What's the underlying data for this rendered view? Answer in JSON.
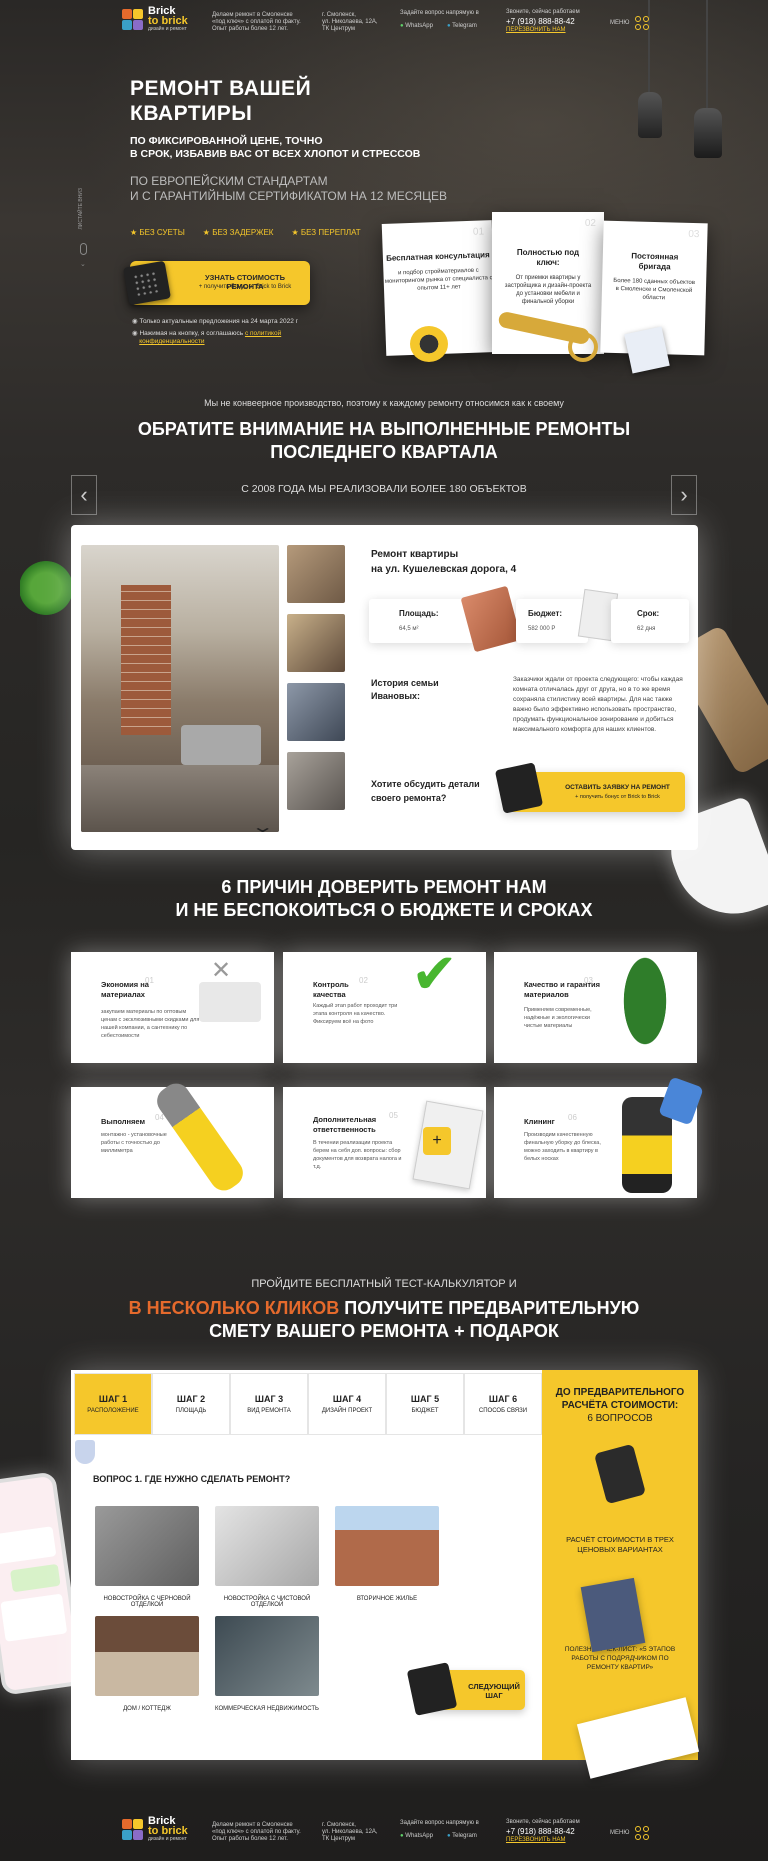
{
  "header": {
    "logo_line1": "Brick",
    "logo_line2": "to brick",
    "logo_tag": "дизайн и ремонт",
    "about": [
      "Делаем ремонт в Смоленске",
      "«под ключ» с оплатой по факту.",
      "Опыт работы более 12 лет."
    ],
    "address": [
      "г. Смоленск,",
      "ул. Николаева, 12А,",
      "ТК Центрум"
    ],
    "ask_label": "Задайте вопрос напрямую в",
    "whatsapp": "WhatsApp",
    "telegram": "Telegram",
    "call_label": "Звоните, сейчас работаем",
    "phone": "+7 (918) 888-88-42",
    "callback": "ПЕРЕЗВОНИТЬ НАМ",
    "menu": "МЕНЮ"
  },
  "hero": {
    "title_1": "РЕМОНТ ВАШЕЙ",
    "title_2": "КВАРТИРЫ",
    "sub_1": "ПО ФИКСИРОВАННОЙ ЦЕНЕ, ТОЧНО",
    "sub_2": "В СРОК, ИЗБАВИВ ВАС ОТ ВСЕХ ХЛОПОТ И СТРЕССОВ",
    "sub_3": "ПО ЕВРОПЕЙСКИМ СТАНДАРТАМ",
    "sub_4": "И С ГАРАНТИЙНЫМ СЕРТИФИКАТОМ НА 12 МЕСЯЦЕВ",
    "perks": [
      "БЕЗ СУЕТЫ",
      "БЕЗ ЗАДЕРЖЕК",
      "БЕЗ ПЕРЕПЛАТ"
    ],
    "cta_title": "УЗНАТЬ СТОИМОСТЬ РЕМОНТА",
    "cta_sub": "+ получить бонус от Brick to Brick",
    "note_1": "Только актуальные предложения на 24 марта 2022 г",
    "note_2a": "Нажимая на кнопку, я соглашаюсь",
    "note_2b": "с политикой",
    "note_2c": "конфиденциальности",
    "scroll": "ЛИСТАЙТЕ ВНИЗ"
  },
  "feature_cards": [
    {
      "num": "01",
      "title": "Бесплатная консультация",
      "text": "и подбор стройматериалов с мониторингом рынка от специалиста с опытом 11+ лет"
    },
    {
      "num": "02",
      "title": "Полностью под ключ:",
      "text": "От приемки квартиры у застройщика и дизайн-проекта до установки мебели и финальной уборки"
    },
    {
      "num": "03",
      "title": "Постоянная бригада",
      "text": "Более 180 сданных объектов в Смоленске и Смоленской области"
    }
  ],
  "works": {
    "intro": "Мы не конвеерное производство, поэтому к каждому ремонту относимся как к своему",
    "title_1": "ОБРАТИТЕ ВНИМАНИЕ НА ВЫПОЛНЕННЫЕ РЕМОНТЫ",
    "title_2": "ПОСЛЕДНЕГО КВАРТАЛА",
    "since": "С 2008 ГОДА МЫ РЕАЛИЗОВАЛИ БОЛЕЕ 180 ОБЪЕКТОВ",
    "project_title_1": "Ремонт квартиры",
    "project_title_2": "на ул. Кушелевская дорога, 4",
    "area_label": "Площадь:",
    "area_value": "64,5 м²",
    "budget_label": "Бюджет:",
    "budget_value": "582 000 Р",
    "term_label": "Срок:",
    "term_value": "62 дня",
    "history_1": "История семьи",
    "history_2": "Ивановых:",
    "history_text": "Заказчики ждали от проекта следующего: чтобы каждая комната отличалась друг от друга, но в то же время сохраняла стилистику всей квартиры. Для нас также важно было эффективно использовать пространство, продумать функциональное зонирование и добиться максимального комфорта для наших клиентов.",
    "discuss_1": "Хотите обсудить детали",
    "discuss_2": "своего ремонта?",
    "btn_title": "ОСТАВИТЬ ЗАЯВКУ НА РЕМОНТ",
    "btn_sub": "+ получить бонус от Brick to Brick"
  },
  "reasons": {
    "title_1": "6 ПРИЧИН ДОВЕРИТЬ РЕМОНТ НАМ",
    "title_2": "И НЕ БЕСПОКОИТЬСЯ О БЮДЖЕТЕ И СРОКАХ",
    "items": [
      {
        "num": "01",
        "title": "Экономия на материалах",
        "text": "закупаем материалы по оптовым ценам с эксклюзивными скидками для нашей компании, а сантехнику по себестоимости"
      },
      {
        "num": "02",
        "title": "Контроль качества",
        "text": "Каждый этап работ проходит три этапа контроля на качество. Фиксируем всё на фото"
      },
      {
        "num": "03",
        "title": "Качество и гарантия материалов",
        "text": "Применяем современные, надёжные и экологически чистые материалы"
      },
      {
        "num": "04",
        "title": "Выполняем",
        "text": "монтажно - установочные работы с точностью до миллиметра"
      },
      {
        "num": "05",
        "title": "Дополнительная ответственность",
        "text": "В течении реализации проекта берем на себя доп. вопросы: сбор документов для возврата налога и т.д."
      },
      {
        "num": "06",
        "title": "Клининг",
        "text": "Производим качественную финальную уборку до блеска, можно заходить в квартиру в белых носках"
      }
    ]
  },
  "quiz": {
    "intro": "ПРОЙДИТЕ БЕСПЛАТНЫЙ ТЕСТ-КАЛЬКУЛЯТОР И",
    "title_hl": "В НЕСКОЛЬКО КЛИКОВ",
    "title_rest": "ПОЛУЧИТЕ ПРЕДВАРИТЕЛЬНУЮ",
    "title_2": "СМЕТУ ВАШЕГО РЕМОНТА + ПОДАРОК",
    "tabs": [
      {
        "step": "ШАГ 1",
        "name": "РАСПОЛОЖЕНИЕ"
      },
      {
        "step": "ШАГ 2",
        "name": "ПЛОЩАДЬ"
      },
      {
        "step": "ШАГ 3",
        "name": "ВИД РЕМОНТА"
      },
      {
        "step": "ШАГ 4",
        "name": "ДИЗАЙН ПРОЕКТ"
      },
      {
        "step": "ШАГ 5",
        "name": "БЮДЖЕТ"
      },
      {
        "step": "ШАГ 6",
        "name": "СПОСОБ СВЯЗИ"
      }
    ],
    "question": "ВОПРОС 1. ГДЕ НУЖНО СДЕЛАТЬ РЕМОНТ?",
    "options": [
      "НОВОСТРОЙКА С ЧЕРНОВОЙ ОТДЕЛКОЙ",
      "НОВОСТРОЙКА С ЧИСТОВОЙ ОТДЕЛКОЙ",
      "ВТОРИЧНОЕ ЖИЛЬЕ",
      "ДОМ / КОТТЕДЖ",
      "КОММЕРЧЕСКАЯ НЕДВИЖИМОСТЬ"
    ],
    "next_1": "СЛЕДУЮЩИЙ",
    "next_2": "ШАГ",
    "panel_title_1": "ДО ПРЕДВАРИТЕЛЬНОГО",
    "panel_title_2": "РАСЧЁТА СТОИМОСТИ:",
    "panel_count": "6 ВОПРОСОВ",
    "panel_p1": "РАСЧЁТ СТОИМОСТИ В ТРЕХ ЦЕНОВЫХ ВАРИАНТАХ",
    "panel_p2": "ПОЛЕЗНЫЙ ЧЕК-ЛИСТ: «5 ЭТАПОВ РАБОТЫ С ПОДРЯДЧИКОМ ПО РЕМОНТУ КВАРТИР»"
  },
  "colors": {
    "accent": "#f5c72b",
    "highlight": "#e56a2c",
    "dark": "#222222"
  }
}
